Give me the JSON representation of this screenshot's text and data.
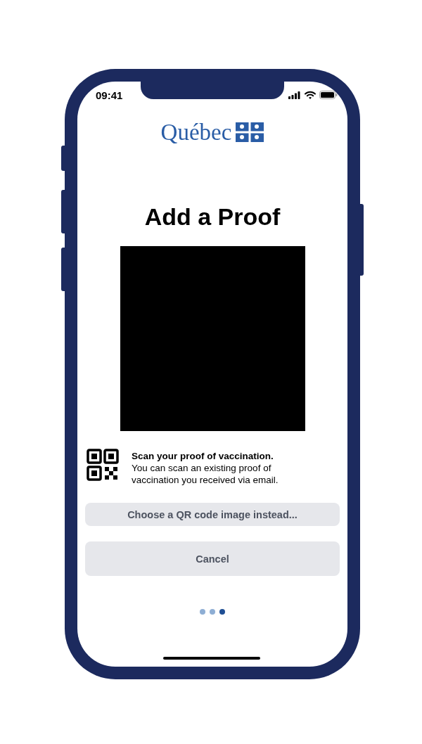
{
  "status_bar": {
    "time": "09:41"
  },
  "logo": {
    "text": "Québec"
  },
  "title": "Add a Proof",
  "camera": {
    "kind": "viewfinder"
  },
  "instructions": {
    "heading": "Scan your proof of vaccination.",
    "body": "You can scan an existing proof of vaccination you received via email."
  },
  "buttons": [
    {
      "label": "Choose a QR code image instead...",
      "kind": "secondary"
    },
    {
      "label": "Cancel",
      "kind": "primary"
    }
  ],
  "pager": [
    {
      "selected": false
    },
    {
      "selected": false
    },
    {
      "selected": true
    }
  ]
}
